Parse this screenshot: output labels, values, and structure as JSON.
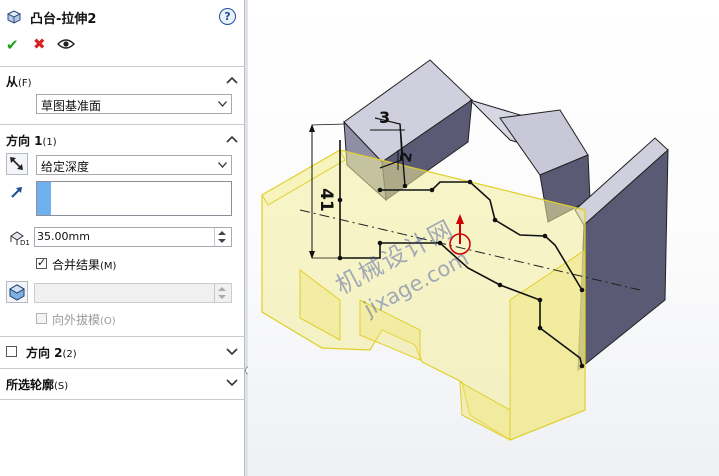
{
  "panel": {
    "title": "凸台-拉伸2",
    "help_glyph": "?",
    "ok_glyph": "✔",
    "cancel_glyph": "✖"
  },
  "from_section": {
    "title": "从",
    "shortcut": "(F)",
    "start_condition": "草图基准面"
  },
  "direction1": {
    "title": "方向 1",
    "shortcut": "(1)",
    "end_condition": "给定深度",
    "depth": "35.00mm",
    "merge_label": "合并结果",
    "merge_shortcut": "(M)",
    "merge_checked": true,
    "draft_label": "向外拔模",
    "draft_shortcut": "(O)",
    "draft_checked": false
  },
  "direction2": {
    "title": "方向 2",
    "shortcut": "(2)",
    "checked": false
  },
  "selected_contours": {
    "title": "所选轮廓",
    "shortcut": "(S)"
  },
  "viewport": {
    "dim_top": "3",
    "dim_side": "2",
    "dim_height": "41",
    "watermark_cn": "机械设计网",
    "watermark_url": "jixage.com"
  },
  "colors": {
    "accent_blue": "#6fb0ee",
    "preview_yellow": "#f3ec9a",
    "body_dark": "#5b5a74",
    "body_top": "#c9c8d8"
  },
  "icons": {
    "feature": "extrude-boss-icon",
    "help": "help-icon",
    "ok": "checkmark-icon",
    "cancel": "close-icon",
    "preview": "eye-icon",
    "reverse": "reverse-direction-icon",
    "direction_vector": "direction-arrow-icon",
    "depth": "depth-icon",
    "draft": "draft-icon"
  }
}
